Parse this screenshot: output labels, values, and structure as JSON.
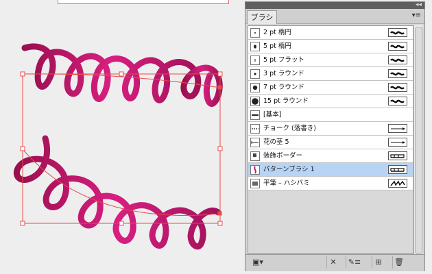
{
  "panel": {
    "tab": "ブラシ",
    "collapse_glyph": "◂◂",
    "menu_glyph": "▾≡"
  },
  "brushes": [
    {
      "label": "2 pt 楕円",
      "thumb": "dot-small",
      "type": "calligraphic"
    },
    {
      "label": "5 pt 楕円",
      "thumb": "dot-oval",
      "type": "calligraphic"
    },
    {
      "label": "5 pt フラット",
      "thumb": "dash",
      "type": "calligraphic"
    },
    {
      "label": "3 pt ラウンド",
      "thumb": "dot-medium",
      "type": "calligraphic"
    },
    {
      "label": "7 pt ラウンド",
      "thumb": "dot-large",
      "type": "calligraphic"
    },
    {
      "label": "15 pt ラウンド",
      "thumb": "dot-xlarge",
      "type": "calligraphic"
    },
    {
      "label": "[基本]",
      "thumb": "line-thick",
      "type": "none"
    },
    {
      "label": "チョーク (落書き)",
      "thumb": "line-chalk",
      "type": "art"
    },
    {
      "label": "花の茎 5",
      "thumb": "line-arrow",
      "type": "art"
    },
    {
      "label": "装飾ボーダー",
      "thumb": "corner",
      "type": "pattern"
    },
    {
      "label": "パターンブラシ 1",
      "thumb": "spiral",
      "type": "pattern",
      "selected": true
    },
    {
      "label": "平筆 – ハシバミ",
      "thumb": "flat",
      "type": "bristle"
    }
  ],
  "toolbar": {
    "libraries": "▣▾",
    "remove_stroke": "✕",
    "options": "✎≡",
    "new_brush": "⊞",
    "delete": "🗑"
  },
  "colors": {
    "ribbon": "#c2176e",
    "bounds": "#e84a4a",
    "selection": "#b7d4f5"
  }
}
